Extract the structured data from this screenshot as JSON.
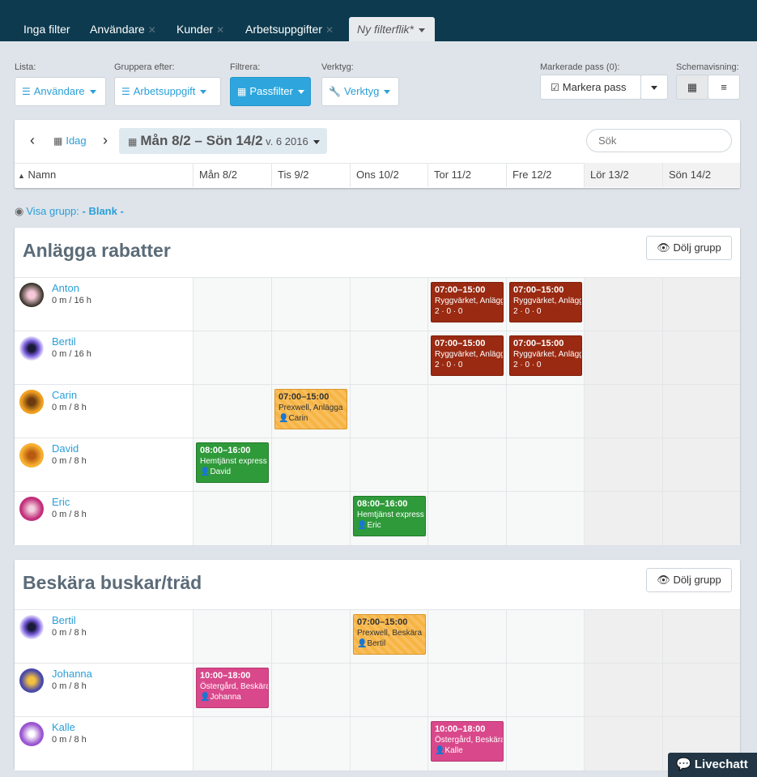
{
  "tabs": [
    {
      "label": "Inga filter",
      "closable": false
    },
    {
      "label": "Användare",
      "closable": true
    },
    {
      "label": "Kunder",
      "closable": true
    },
    {
      "label": "Arbetsuppgifter",
      "closable": true
    },
    {
      "label": "Ny filterflik*",
      "closable": false
    }
  ],
  "toolbar": {
    "lista_label": "Lista:",
    "lista_value": "Användare",
    "gruppera_label": "Gruppera efter:",
    "gruppera_value": "Arbetsuppgift",
    "filtrera_label": "Filtrera:",
    "filtrera_value": "Passfilter",
    "verktyg_label": "Verktyg:",
    "verktyg_value": "Verktyg",
    "markerade_label": "Markerade pass (0):",
    "markera_button": "Markera pass",
    "schema_label": "Schemavisning:"
  },
  "nav": {
    "today": "Idag",
    "range": "Mån 8/2 – Sön 14/2",
    "week": "v. 6 2016",
    "search_placeholder": "Sök"
  },
  "columns": {
    "name": "Namn",
    "days": [
      "Mån 8/2",
      "Tis 9/2",
      "Ons 10/2",
      "Tor 11/2",
      "Fre 12/2",
      "Lör 13/2",
      "Sön 14/2"
    ]
  },
  "visa_grupp": {
    "label": "Visa grupp:",
    "value": "- Blank -"
  },
  "groups": [
    {
      "title": "Anlägga rabatter",
      "hide_label": "Dölj grupp",
      "rows": [
        {
          "name": "Anton",
          "hours": "0 m / 16 h",
          "shifts": [
            {
              "day": 3,
              "time": "07:00–15:00",
              "desc": "Ryggvärket, Anlägga",
              "stats": "2 · 0 · 0",
              "color": "red"
            },
            {
              "day": 4,
              "time": "07:00–15:00",
              "desc": "Ryggvärket, Anlägga",
              "stats": "2 · 0 · 0",
              "color": "red"
            }
          ]
        },
        {
          "name": "Bertil",
          "hours": "0 m / 16 h",
          "shifts": [
            {
              "day": 3,
              "time": "07:00–15:00",
              "desc": "Ryggvärket, Anlägga",
              "stats": "2 · 0 · 0",
              "color": "red"
            },
            {
              "day": 4,
              "time": "07:00–15:00",
              "desc": "Ryggvärket, Anlägga",
              "stats": "2 · 0 · 0",
              "color": "red"
            }
          ]
        },
        {
          "name": "Carin",
          "hours": "0 m / 8 h",
          "shifts": [
            {
              "day": 1,
              "time": "07:00–15:00",
              "desc": "Prexwell, Anlägga",
              "person": "Carin",
              "color": "yellow"
            }
          ]
        },
        {
          "name": "David",
          "hours": "0 m / 8 h",
          "shifts": [
            {
              "day": 0,
              "time": "08:00–16:00",
              "desc": "Hemtjänst express",
              "person": "David",
              "color": "green"
            }
          ]
        },
        {
          "name": "Eric",
          "hours": "0 m / 8 h",
          "shifts": [
            {
              "day": 2,
              "time": "08:00–16:00",
              "desc": "Hemtjänst express",
              "person": "Eric",
              "color": "green"
            }
          ]
        }
      ]
    },
    {
      "title": "Beskära buskar/träd",
      "hide_label": "Dölj grupp",
      "rows": [
        {
          "name": "Bertil",
          "hours": "0 m / 8 h",
          "shifts": [
            {
              "day": 2,
              "time": "07:00–15:00",
              "desc": "Prexwell, Beskära",
              "person": "Bertil",
              "color": "yellow"
            }
          ]
        },
        {
          "name": "Johanna",
          "hours": "0 m / 8 h",
          "shifts": [
            {
              "day": 0,
              "time": "10:00–18:00",
              "desc": "Östergård, Beskära",
              "person": "Johanna",
              "color": "pink"
            }
          ]
        },
        {
          "name": "Kalle",
          "hours": "0 m / 8 h",
          "shifts": [
            {
              "day": 3,
              "time": "10:00–18:00",
              "desc": "Östergård, Beskära",
              "person": "Kalle",
              "color": "pink"
            }
          ]
        }
      ]
    }
  ],
  "livechat": "Livechatt",
  "colors": {
    "topbar": "#0d3a4e",
    "accent": "#2ea6dd",
    "red": "#9a2a12",
    "yellow": "#f7b443",
    "green": "#2f9a3a",
    "pink": "#d9488b"
  }
}
